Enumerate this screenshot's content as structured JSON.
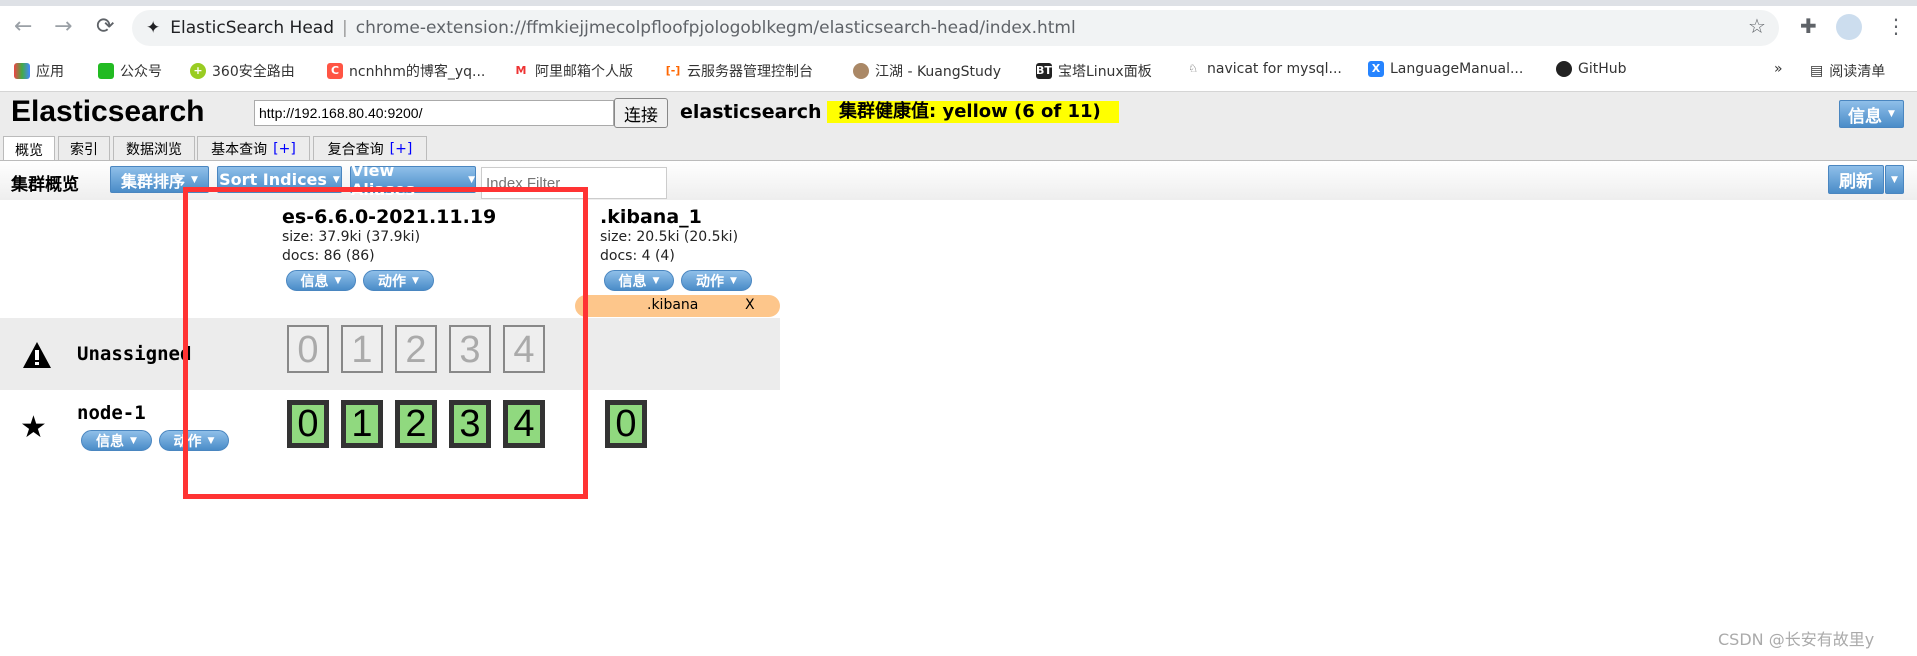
{
  "browser": {
    "page_title": "ElasticSearch Head",
    "url": "chrome-extension://ffmkiejjmecolpfloofpjologoblkegm/elasticsearch-head/index.html",
    "bookmarks": [
      {
        "label": "应用",
        "icon": "apps-grid-icon"
      },
      {
        "label": "公众号",
        "icon": "wechat-icon"
      },
      {
        "label": "360安全路由",
        "icon": "360-icon"
      },
      {
        "label": "ncnhhm的博客_yq...",
        "icon": "csdn-icon"
      },
      {
        "label": "阿里邮箱个人版",
        "icon": "aliyun-mail-icon"
      },
      {
        "label": "云服务器管理控制台",
        "icon": "aliyun-icon"
      },
      {
        "label": "江湖 - KuangStudy",
        "icon": "avatar-icon"
      },
      {
        "label": "宝塔Linux面板",
        "icon": "bt-icon"
      },
      {
        "label": "navicat for mysql...",
        "icon": "navicat-icon"
      },
      {
        "label": "LanguageManual...",
        "icon": "confluence-icon"
      },
      {
        "label": "GitHub",
        "icon": "github-icon"
      }
    ],
    "more": "»",
    "reading_list": "阅读清单"
  },
  "header": {
    "logo": "Elasticsearch",
    "connect_url": "http://192.168.80.40:9200/",
    "connect_label": "连接",
    "cluster_name": "elasticsearch",
    "health": "集群健康值: yellow (6 of 11)",
    "health_color": "#ffff00",
    "info_label": "信息"
  },
  "tabs": [
    {
      "label": "概览",
      "active": true
    },
    {
      "label": "索引"
    },
    {
      "label": "数据浏览"
    },
    {
      "label": "基本查询",
      "plus": "[+]"
    },
    {
      "label": "复合查询",
      "plus": "[+]"
    }
  ],
  "toolbar": {
    "title": "集群概览",
    "sort_cluster": "集群排序",
    "sort_indices": "Sort Indices",
    "view_aliases": "View Aliases",
    "index_filter_placeholder": "Index Filter",
    "refresh": "刷新"
  },
  "indices": [
    {
      "name": "es-6.6.0-2021.11.19",
      "size": "size: 37.9ki (37.9ki)",
      "docs": "docs: 86 (86)",
      "info": "信息",
      "action": "动作"
    },
    {
      "name": ".kibana_1",
      "size": "size: 20.5ki (20.5ki)",
      "docs": "docs: 4 (4)",
      "info": "信息",
      "action": "动作",
      "alias": ".kibana",
      "alias_close": "X"
    }
  ],
  "rows": {
    "unassigned": {
      "label": "Unassigned",
      "shards": [
        "0",
        "1",
        "2",
        "3",
        "4"
      ]
    },
    "node": {
      "label": "node-1",
      "info": "信息",
      "action": "动作",
      "shards": [
        "0",
        "1",
        "2",
        "3",
        "4"
      ],
      "kibana_shards": [
        "0"
      ]
    }
  },
  "colors": {
    "shard_started": "#90d97f",
    "highlight_box": "#ff3333",
    "alias": "#fdc68b"
  },
  "watermark": "CSDN @长安有故里y"
}
